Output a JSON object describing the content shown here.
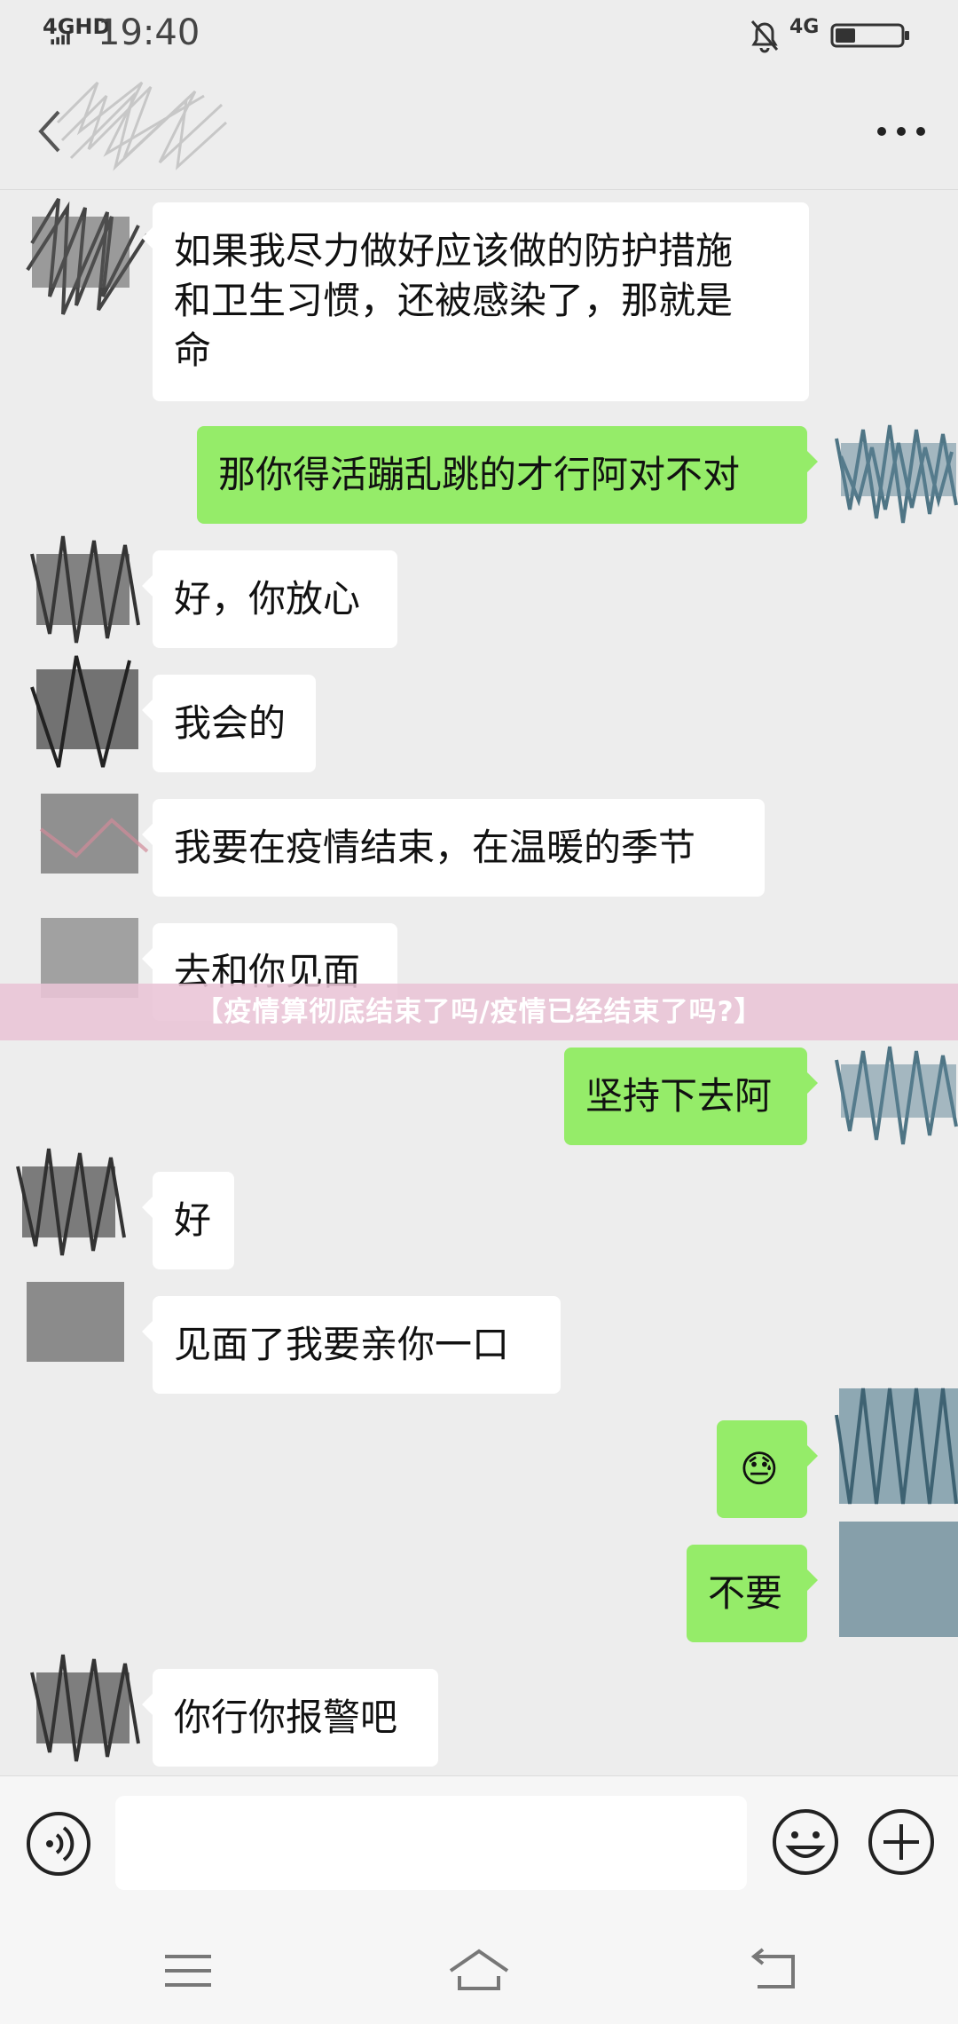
{
  "status_bar": {
    "network": "4GHD",
    "time": "19:40",
    "network_right": "4G"
  },
  "nav": {
    "back_icon": "chevron-left-icon",
    "more_icon": "more-dots-icon"
  },
  "messages": [
    {
      "side": "in",
      "text": "如果我尽力做好应该做的防护措施\n和卫生习惯，还被感染了，那就是\n命"
    },
    {
      "side": "out",
      "text": "那你得活蹦乱跳的才行阿对不对"
    },
    {
      "side": "in",
      "text": "好，你放心"
    },
    {
      "side": "in",
      "text": "我会的"
    },
    {
      "side": "in",
      "text": "我要在疫情结束，在温暖的季节"
    },
    {
      "side": "in",
      "text": "去和你见面"
    },
    {
      "side": "out",
      "text": "坚持下去阿"
    },
    {
      "side": "in",
      "text": "好"
    },
    {
      "side": "in",
      "text": "见面了我要亲你一口"
    },
    {
      "side": "out",
      "text": "😓"
    },
    {
      "side": "out",
      "text": "不要"
    },
    {
      "side": "in",
      "text": "你行你报警吧"
    }
  ],
  "banner": {
    "text": "【疫情算彻底结束了吗/疫情已经结束了吗?】"
  },
  "input_bar": {
    "voice_icon": "voice-icon",
    "emoji_icon": "emoji-icon",
    "plus_icon": "plus-icon"
  },
  "colors": {
    "outgoing_bubble": "#95ec69",
    "incoming_bubble": "#ffffff",
    "background": "#ededed",
    "banner": "#e9c4d6"
  },
  "system_nav": {
    "menu_icon": "menu-icon",
    "home_icon": "home-icon",
    "back_icon": "back-arrow-icon"
  }
}
